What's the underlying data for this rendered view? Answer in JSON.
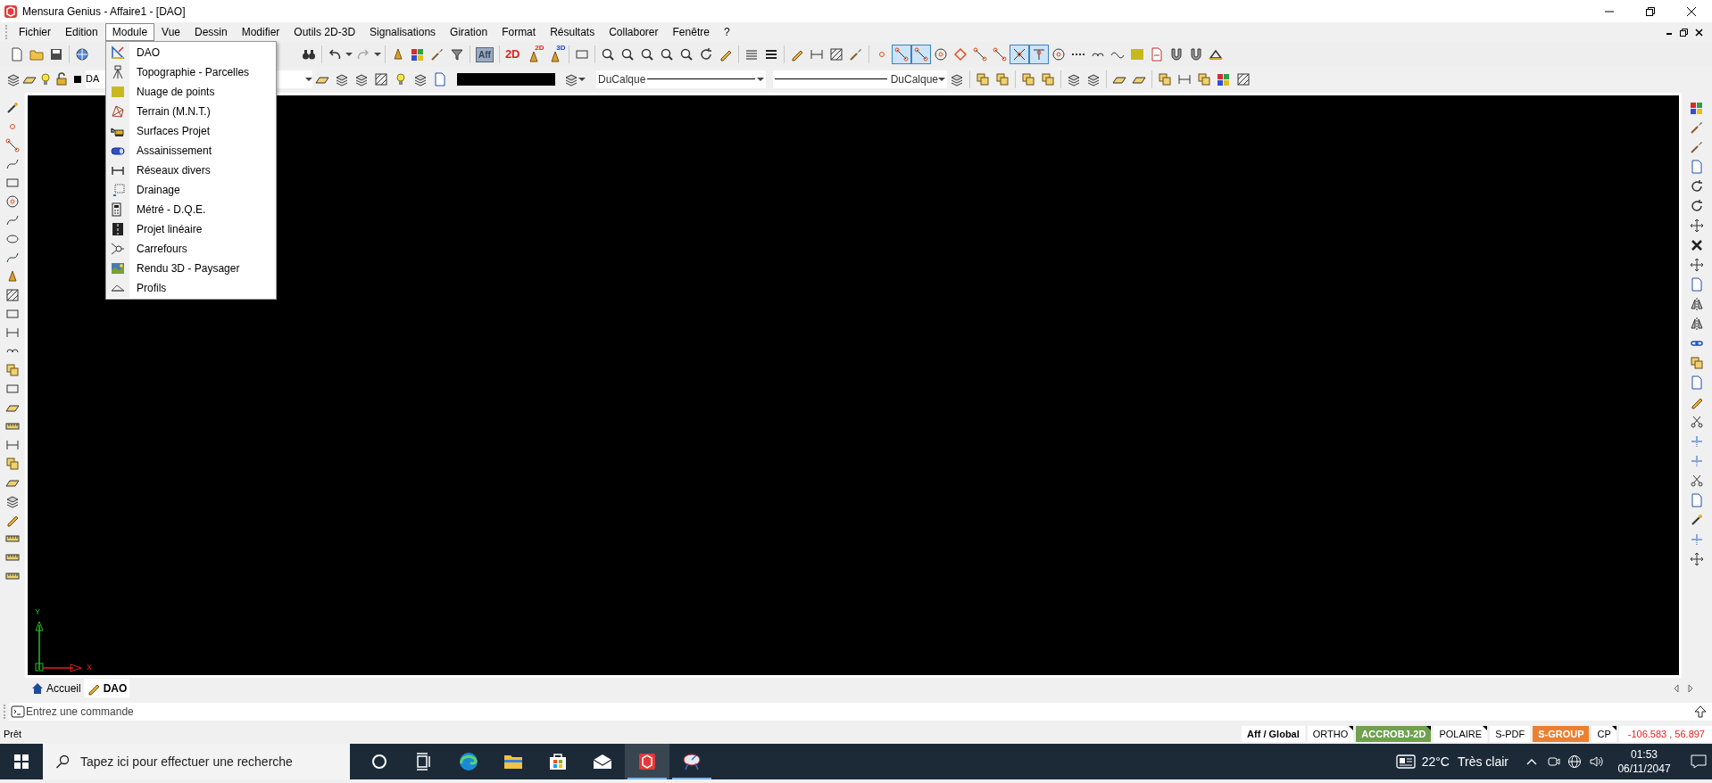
{
  "window": {
    "title": "Mensura Genius - Affaire1 - [DAO]"
  },
  "menu_bar": [
    {
      "label": "Fichier",
      "selected": false
    },
    {
      "label": "Edition",
      "selected": false
    },
    {
      "label": "Module",
      "selected": true
    },
    {
      "label": "Vue",
      "selected": false
    },
    {
      "label": "Dessin",
      "selected": false
    },
    {
      "label": "Modifier",
      "selected": false
    },
    {
      "label": "Outils 2D-3D",
      "selected": false
    },
    {
      "label": "Signalisations",
      "selected": false
    },
    {
      "label": "Giration",
      "selected": false
    },
    {
      "label": "Format",
      "selected": false
    },
    {
      "label": "Résultats",
      "selected": false
    },
    {
      "label": "Collaborer",
      "selected": false
    },
    {
      "label": "Fenêtre",
      "selected": false
    },
    {
      "label": "?",
      "selected": false
    }
  ],
  "module_menu": [
    {
      "kind": "drafting",
      "label": "DAO"
    },
    {
      "kind": "survey",
      "label": "Topographie - Parcelles"
    },
    {
      "kind": "pointcloud",
      "label": "Nuage de points"
    },
    {
      "kind": "terrain",
      "label": "Terrain (M.N.T.)"
    },
    {
      "kind": "excavator",
      "label": "Surfaces Projet"
    },
    {
      "kind": "pipe",
      "label": "Assainissement"
    },
    {
      "kind": "network",
      "label": "Réseaux divers"
    },
    {
      "kind": "drainage",
      "label": "Drainage"
    },
    {
      "kind": "quantities",
      "label": "Métré - D.Q.E."
    },
    {
      "kind": "road",
      "label": "Projet linéaire"
    },
    {
      "kind": "junction",
      "label": "Carrefours"
    },
    {
      "kind": "render",
      "label": "Rendu 3D - Paysager"
    },
    {
      "kind": "profile",
      "label": "Profils"
    }
  ],
  "toolbar": {
    "text_button": "Aff",
    "view_button": "2D",
    "hand_badges": [
      "2D",
      "3D"
    ],
    "layer": "DA",
    "linetype": "DuCalque",
    "lineweight": "DuCalque"
  },
  "snap_buttons": [
    {
      "kind": "dot",
      "on": false
    },
    {
      "kind": "line",
      "on": true
    },
    {
      "kind": "line",
      "on": true
    },
    {
      "kind": "circle",
      "on": false
    },
    {
      "kind": "diamond",
      "on": false
    },
    {
      "kind": "line",
      "on": false
    },
    {
      "kind": "line",
      "on": false
    },
    {
      "kind": "cross",
      "on": true
    },
    {
      "kind": "tee",
      "on": true
    },
    {
      "kind": "circle",
      "on": false
    },
    {
      "kind": "dashes",
      "on": false
    },
    {
      "kind": "arcs",
      "on": false
    },
    {
      "kind": "wave",
      "on": false
    },
    {
      "kind": "tile",
      "on": false
    },
    {
      "kind": "pdf",
      "on": false
    },
    {
      "kind": "magnet",
      "on": false
    },
    {
      "kind": "magnet",
      "on": false
    },
    {
      "kind": "level",
      "on": false
    }
  ],
  "canvas": {
    "y_axis": "Y",
    "x_axis": "X"
  },
  "tabs": [
    {
      "label": "Accueil",
      "selected": false
    },
    {
      "label": "DAO",
      "selected": true
    }
  ],
  "command_line": {
    "placeholder": "Entrez une commande"
  },
  "status_bar": {
    "message": "Prêt",
    "toggles": [
      {
        "label": "Aff / Global",
        "kind": "mode",
        "on": false,
        "has_menu": false
      },
      {
        "label": "ORTHO",
        "kind": "toggle",
        "on": false,
        "has_menu": true
      },
      {
        "label": "ACCROBJ-2D",
        "kind": "toggle",
        "on": true,
        "has_menu": true,
        "color": "#70a050"
      },
      {
        "label": "POLAIRE",
        "kind": "toggle",
        "on": false,
        "has_menu": true
      },
      {
        "label": "S-PDF",
        "kind": "toggle",
        "on": false,
        "has_menu": false
      },
      {
        "label": "S-GROUP",
        "kind": "toggle",
        "on": true,
        "has_menu": false,
        "color": "#ec8030"
      },
      {
        "label": "CP",
        "kind": "toggle",
        "on": false,
        "has_menu": true
      }
    ],
    "coordinates": "-106.583 , 56.897"
  },
  "taskbar": {
    "search_placeholder": "Tapez ici pour effectuer une recherche",
    "apps": [
      {
        "kind": "cortana",
        "selected": false,
        "running": false
      },
      {
        "kind": "taskview",
        "selected": false,
        "running": false
      },
      {
        "kind": "browser",
        "selected": false,
        "running": false
      },
      {
        "kind": "folder",
        "selected": false,
        "running": false
      },
      {
        "kind": "store",
        "selected": false,
        "running": false
      },
      {
        "kind": "mail",
        "selected": false,
        "running": false
      },
      {
        "kind": "cad",
        "selected": true,
        "running": true
      },
      {
        "kind": "satellite",
        "selected": false,
        "running": true
      }
    ],
    "temperature": "22°C",
    "weather": "Très clair",
    "time": "01:53",
    "date": "06/11/2047"
  }
}
